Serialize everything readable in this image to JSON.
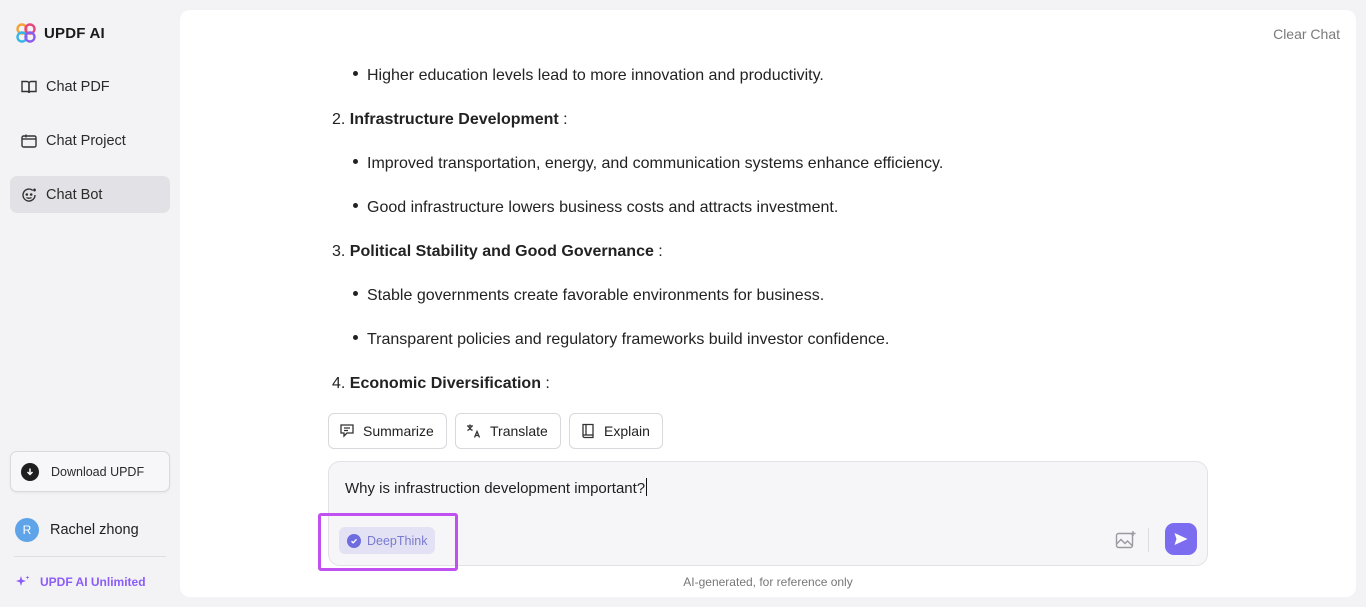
{
  "app": {
    "name": "UPDF AI"
  },
  "sidebar": {
    "items": [
      {
        "label": "Chat PDF",
        "icon": "book-open-icon",
        "active": false
      },
      {
        "label": "Chat Project",
        "icon": "folder-icon",
        "active": false
      },
      {
        "label": "Chat Bot",
        "icon": "bot-face-icon",
        "active": true
      }
    ],
    "download_label": "Download UPDF",
    "user": {
      "initial": "R",
      "name": "Rachel zhong"
    },
    "unlimited_label": "UPDF AI Unlimited"
  },
  "header": {
    "clear_chat": "Clear Chat"
  },
  "chat": {
    "lines": [
      {
        "kind": "bullet",
        "text": "Higher education levels lead to more innovation and productivity."
      },
      {
        "kind": "numbered",
        "num": "2.",
        "title": "Infrastructure Development",
        "suffix": " :"
      },
      {
        "kind": "bullet",
        "text": "Improved transportation, energy, and communication systems enhance efficiency."
      },
      {
        "kind": "bullet",
        "text": "Good infrastructure lowers business costs and attracts investment."
      },
      {
        "kind": "numbered",
        "num": "3.",
        "title": "Political Stability and Good Governance",
        "suffix": " :"
      },
      {
        "kind": "bullet",
        "text": "Stable governments create favorable environments for business."
      },
      {
        "kind": "bullet",
        "text": "Transparent policies and regulatory frameworks build investor confidence."
      },
      {
        "kind": "numbered",
        "num": "4.",
        "title": "Economic Diversification",
        "suffix": " :"
      }
    ]
  },
  "actions": {
    "summarize": "Summarize",
    "translate": "Translate",
    "explain": "Explain"
  },
  "input": {
    "value": "Why is infrastruction development important?",
    "deepthink_label": "DeepThink"
  },
  "footer": {
    "disclaimer": "AI-generated, for reference only"
  },
  "colors": {
    "accent": "#7c6cf0",
    "highlight": "#c050f0",
    "unlimited": "#8b5cf6"
  }
}
